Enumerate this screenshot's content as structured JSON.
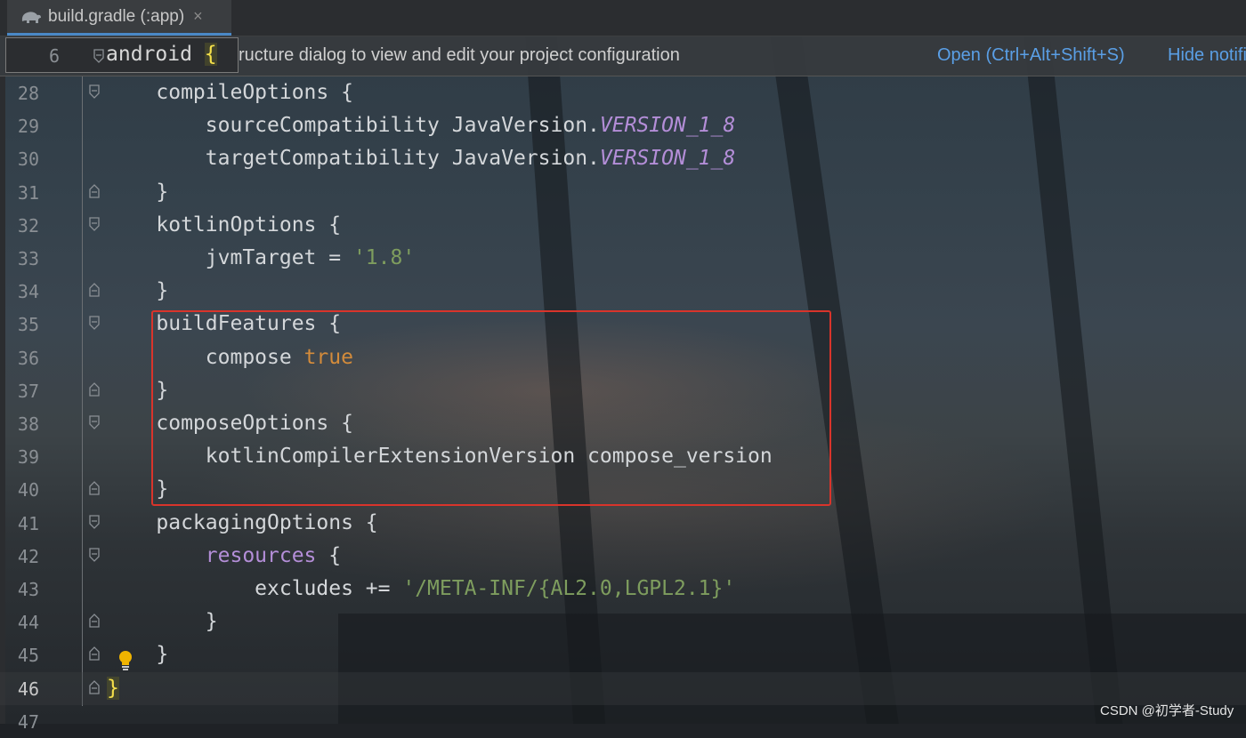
{
  "tab": {
    "title": "build.gradle (:app)",
    "close": "×",
    "icon": "gradle-elephant-icon"
  },
  "notification": {
    "message": "ructure dialog to view and edit your project configuration",
    "open_label": "Open (Ctrl+Alt+Shift+S)",
    "hide_label": "Hide notifi"
  },
  "sticky": {
    "line": "6",
    "text": "android ",
    "brace": "{"
  },
  "lines": [
    {
      "n": "28",
      "parts": [
        {
          "t": "    compileOptions {"
        }
      ]
    },
    {
      "n": "29",
      "parts": [
        {
          "t": "        sourceCompatibility JavaVersion."
        },
        {
          "t": "VERSION_1_8",
          "c": "const"
        }
      ]
    },
    {
      "n": "30",
      "parts": [
        {
          "t": "        targetCompatibility JavaVersion."
        },
        {
          "t": "VERSION_1_8",
          "c": "const"
        }
      ]
    },
    {
      "n": "31",
      "parts": [
        {
          "t": "    }"
        }
      ]
    },
    {
      "n": "32",
      "parts": [
        {
          "t": "    kotlinOptions {"
        }
      ]
    },
    {
      "n": "33",
      "parts": [
        {
          "t": "        jvmTarget = "
        },
        {
          "t": "'1.8'",
          "c": "str"
        }
      ]
    },
    {
      "n": "34",
      "parts": [
        {
          "t": "    }"
        }
      ]
    },
    {
      "n": "35",
      "parts": [
        {
          "t": "    buildFeatures {"
        }
      ]
    },
    {
      "n": "36",
      "parts": [
        {
          "t": "        compose "
        },
        {
          "t": "true",
          "c": "kw"
        }
      ]
    },
    {
      "n": "37",
      "parts": [
        {
          "t": "    }"
        }
      ]
    },
    {
      "n": "38",
      "parts": [
        {
          "t": "    composeOptions {"
        }
      ]
    },
    {
      "n": "39",
      "parts": [
        {
          "t": "        kotlinCompilerExtensionVersion compose_version"
        }
      ]
    },
    {
      "n": "40",
      "parts": [
        {
          "t": "    }"
        }
      ]
    },
    {
      "n": "41",
      "parts": [
        {
          "t": "    packagingOptions {"
        }
      ]
    },
    {
      "n": "42",
      "parts": [
        {
          "t": "        "
        },
        {
          "t": "resources",
          "c": "purp"
        },
        {
          "t": " {"
        }
      ]
    },
    {
      "n": "43",
      "parts": [
        {
          "t": "            excludes += "
        },
        {
          "t": "'/META-INF/{AL2.0,LGPL2.1}'",
          "c": "str"
        }
      ]
    },
    {
      "n": "44",
      "parts": [
        {
          "t": "        }"
        }
      ]
    },
    {
      "n": "45",
      "parts": [
        {
          "t": "    }"
        }
      ]
    },
    {
      "n": "46",
      "parts": [
        {
          "t": "}",
          "c": "yb"
        }
      ]
    },
    {
      "n": "47",
      "parts": []
    }
  ],
  "watermark": "CSDN @初学者-Study"
}
